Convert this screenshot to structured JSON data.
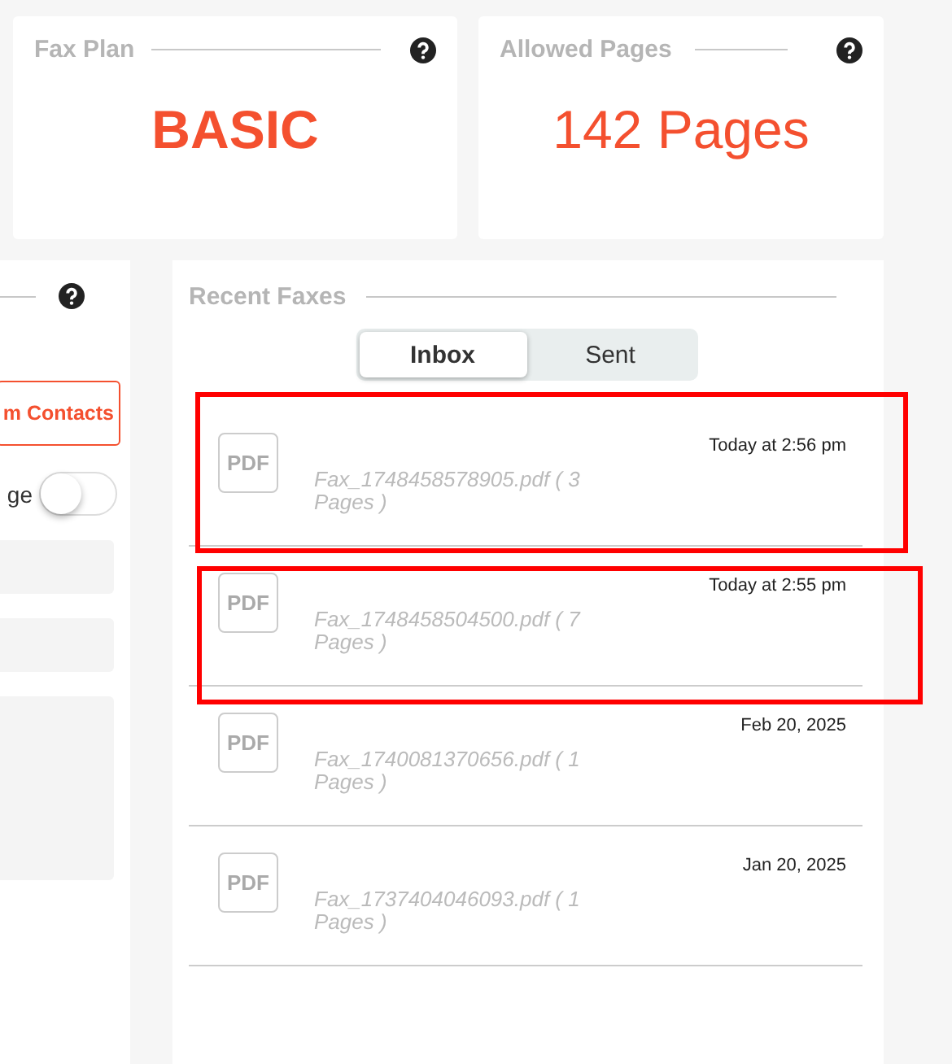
{
  "cards": [
    {
      "title": "Fax Plan",
      "value": "BASIC"
    },
    {
      "title": "Allowed Pages",
      "value": "142 Pages"
    }
  ],
  "left_panel": {
    "button": "m Contacts",
    "toggle": {
      "label": "ge",
      "on": false
    }
  },
  "recent_faxes": {
    "title": "Recent Faxes",
    "tabs": [
      {
        "label": "Inbox",
        "selected": true
      },
      {
        "label": "Sent",
        "selected": false
      }
    ],
    "items": [
      {
        "icon_label": "PDF",
        "file": "Fax_1748458578905.pdf ( 3 Pages )",
        "time": "Today at 2:56 pm",
        "highlighted": true
      },
      {
        "icon_label": "PDF",
        "file": "Fax_1748458504500.pdf ( 7 Pages )",
        "time": "Today at 2:55 pm",
        "highlighted": true
      },
      {
        "icon_label": "PDF",
        "file": "Fax_1740081370656.pdf ( 1 Pages )",
        "time": "Feb 20, 2025",
        "highlighted": false
      },
      {
        "icon_label": "PDF",
        "file": "Fax_1737404046093.pdf ( 1 Pages )",
        "time": "Jan 20, 2025",
        "highlighted": false
      }
    ]
  }
}
